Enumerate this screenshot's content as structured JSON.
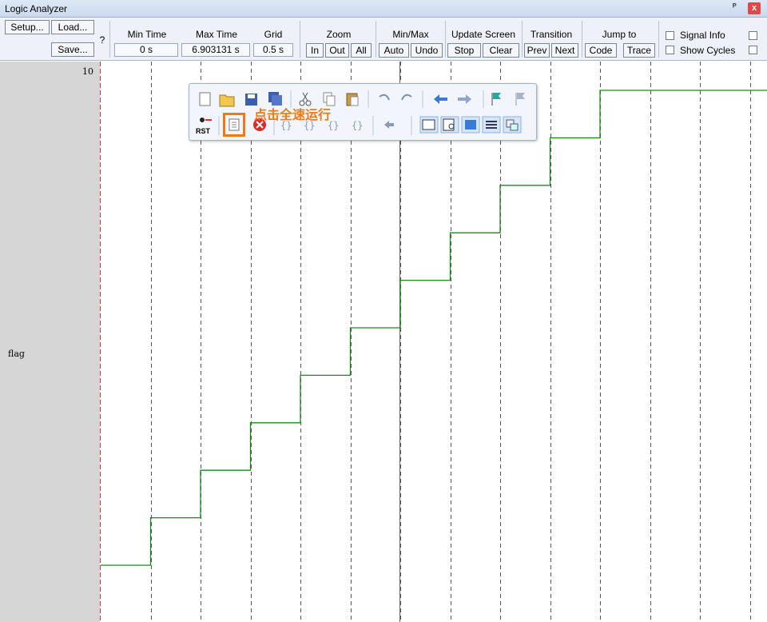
{
  "window": {
    "title": "Logic Analyzer",
    "pin_glyph": "ᵖ",
    "close_glyph": "x"
  },
  "toolbar": {
    "setup": "Setup...",
    "load": "Load...",
    "save": "Save...",
    "help": "?",
    "min_time": {
      "label": "Min Time",
      "value": "0 s"
    },
    "max_time": {
      "label": "Max Time",
      "value": "6.903131 s"
    },
    "grid": {
      "label": "Grid",
      "value": "0.5 s"
    },
    "zoom": {
      "label": "Zoom",
      "in": "In",
      "out": "Out",
      "all": "All"
    },
    "minmax": {
      "label": "Min/Max",
      "auto": "Auto",
      "undo": "Undo"
    },
    "update": {
      "label": "Update Screen",
      "stop": "Stop",
      "clear": "Clear"
    },
    "transition": {
      "label": "Transition",
      "prev": "Prev",
      "next": "Next"
    },
    "jump": {
      "label": "Jump to",
      "code": "Code",
      "trace": "Trace"
    },
    "signal_info": "Signal Info",
    "show_cycles": "Show Cycles"
  },
  "signals": {
    "scale_max": "10",
    "name": "flag"
  },
  "floating_toolbar": {
    "callout": "点击全速运行",
    "rst_label": "RST",
    "row1_icons": [
      "new-file-icon",
      "open-file-icon",
      "save-icon",
      "save-all-icon",
      "cut-icon",
      "copy-icon",
      "paste-icon",
      "undo-icon",
      "redo-icon",
      "back-arrow-icon",
      "forward-arrow-icon",
      "bookmark-flag-icon",
      "bookmark-clear-icon"
    ],
    "row2_icons": [
      "reset-icon",
      "run-icon",
      "stop-icon",
      "step-into-icon",
      "step-over-icon",
      "step-out-icon",
      "run-to-cursor-icon",
      "show-next-statement-icon",
      "command-window-icon",
      "disassembly-window-icon",
      "symbols-window-icon",
      "registers-window-icon",
      "call-stack-icon"
    ]
  },
  "colors": {
    "trace": "#1a8a1a",
    "cursor": "#e03030",
    "highlight": "#f07a12",
    "grid": "#555555"
  },
  "chart_data": {
    "type": "line",
    "title": "",
    "xlabel": "",
    "ylabel": "",
    "xlim": [
      0,
      6.903131
    ],
    "ylim": [
      0,
      10
    ],
    "grid": true,
    "series": [
      {
        "name": "flag",
        "step": true,
        "x": [
          0,
          0.5,
          1.0,
          1.5,
          2.0,
          2.5,
          3.0,
          3.5,
          4.0,
          4.5,
          5.0,
          5.5,
          6.0,
          6.903131
        ],
        "y": [
          0,
          1,
          2,
          3,
          4,
          5,
          6,
          7,
          8,
          9,
          10,
          10,
          10,
          10
        ]
      }
    ]
  }
}
